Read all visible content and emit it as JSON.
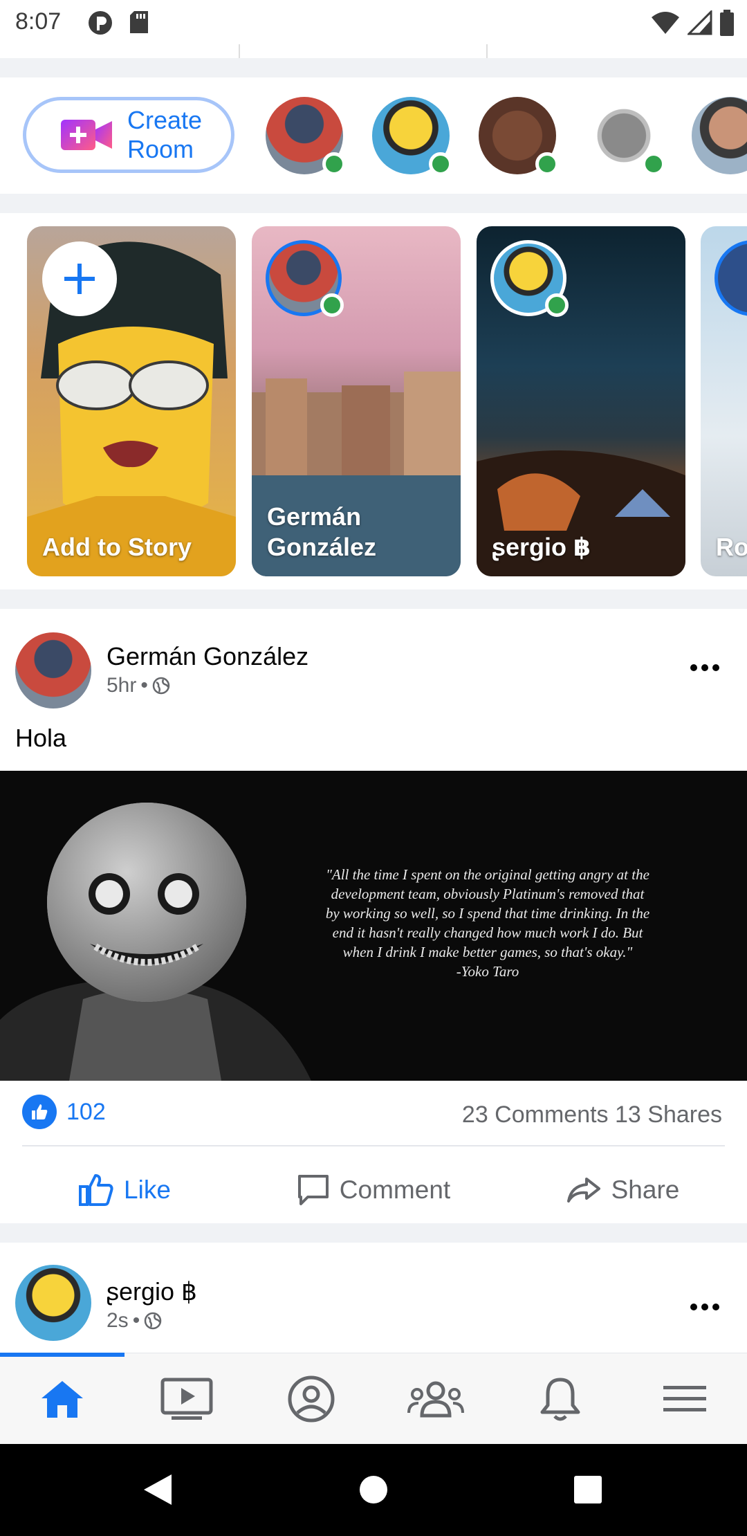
{
  "status_bar": {
    "time": "8:07"
  },
  "rooms": {
    "create_label": "Create Room",
    "avatars": [
      {
        "name": "room-avatar-1",
        "online": true
      },
      {
        "name": "room-avatar-2",
        "online": true
      },
      {
        "name": "room-avatar-3",
        "online": true
      },
      {
        "name": "room-avatar-4",
        "online": true
      },
      {
        "name": "room-avatar-5",
        "online": true
      }
    ]
  },
  "stories": {
    "items": [
      {
        "label": "Add to Story"
      },
      {
        "label": "Germán González"
      },
      {
        "label": "ʂergio ฿"
      },
      {
        "label": "Ro"
      }
    ]
  },
  "post": {
    "author": "Germán González",
    "time": "5hr",
    "separator": "•",
    "text": "Hola",
    "image_quote": "\"All the time I spent on the original getting angry at the development team, obviously Platinum's removed that by working so well, so I spend that time drinking. In the end it hasn't really changed how much work I do. But when I drink I make better games, so that's okay.\"",
    "image_attribution": "-Yoko Taro",
    "like_count": "102",
    "comments": "23 Comments",
    "shares": "13 Shares",
    "actions": {
      "like": "Like",
      "comment": "Comment",
      "share": "Share"
    }
  },
  "post2": {
    "author": "ʂergio ฿",
    "time": "2s",
    "separator": "•"
  },
  "colors": {
    "brand": "#1877f2",
    "online": "#31a24c",
    "secondary_text": "#65676b"
  }
}
